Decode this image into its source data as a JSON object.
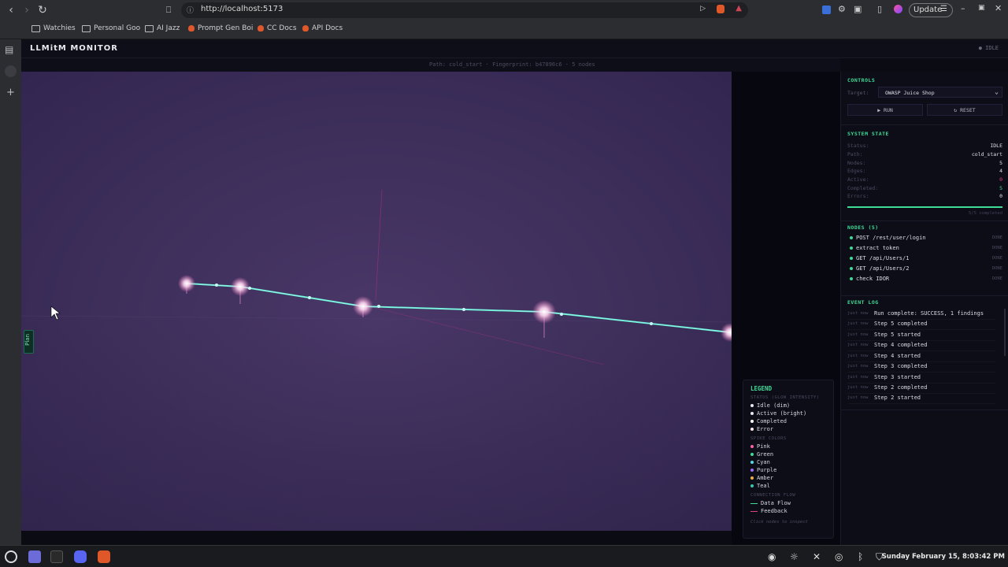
{
  "browser": {
    "url": "http://localhost:5173",
    "update_label": "Update",
    "bookmarks": [
      {
        "label": "Watchies",
        "type": "folder"
      },
      {
        "label": "Personal Goo",
        "type": "folder"
      },
      {
        "label": "AI Jazz",
        "type": "folder"
      },
      {
        "label": "Prompt Gen Boi",
        "type": "link"
      },
      {
        "label": "CC Docs",
        "type": "link"
      },
      {
        "label": "API Docs",
        "type": "link"
      }
    ]
  },
  "app": {
    "title": "LLMitM MONITOR",
    "header_status": "IDLE",
    "path_line": "Path: cold_start · Fingerprint: b47896c6 · 5 nodes",
    "plan_tab": "Plan"
  },
  "controls": {
    "title": "CONTROLS",
    "target_label": "Target:",
    "target_value": "OWASP Juice Shop",
    "run_label": "▶ RUN",
    "reset_label": "↻ RESET"
  },
  "system_state": {
    "title": "SYSTEM STATE",
    "rows": [
      {
        "key": "Status:",
        "value": "IDLE"
      },
      {
        "key": "Path:",
        "value": "cold_start"
      },
      {
        "key": "Nodes:",
        "value": "5"
      },
      {
        "key": "Edges:",
        "value": "4"
      },
      {
        "key": "Active:",
        "value": "0"
      },
      {
        "key": "Completed:",
        "value": "5"
      },
      {
        "key": "Errors:",
        "value": "0"
      }
    ],
    "progress": 1.0,
    "progress_text": "5/5 completed",
    "colors": {
      "active": "#e0437a",
      "completed": "#3ddc97"
    }
  },
  "nodes": {
    "title": "NODES (5)",
    "items": [
      {
        "label": "POST /rest/user/login",
        "status": "DONE"
      },
      {
        "label": "extract token",
        "status": "DONE"
      },
      {
        "label": "GET /api/Users/1",
        "status": "DONE"
      },
      {
        "label": "GET /api/Users/2",
        "status": "DONE"
      },
      {
        "label": "check IDOR",
        "status": "DONE"
      }
    ]
  },
  "event_log": {
    "title": "EVENT LOG",
    "items": [
      {
        "time": "just now",
        "message": "Run complete: SUCCESS, 1 findings"
      },
      {
        "time": "just now",
        "message": "Step 5 completed"
      },
      {
        "time": "just now",
        "message": "Step 5 started"
      },
      {
        "time": "just now",
        "message": "Step 4 completed"
      },
      {
        "time": "just now",
        "message": "Step 4 started"
      },
      {
        "time": "just now",
        "message": "Step 3 completed"
      },
      {
        "time": "just now",
        "message": "Step 3 started"
      },
      {
        "time": "just now",
        "message": "Step 2 completed"
      },
      {
        "time": "just now",
        "message": "Step 2 started"
      }
    ]
  },
  "legend": {
    "title": "LEGEND",
    "status_title": "STATUS (GLOW INTENSITY)",
    "status_items": [
      "Idle (dim)",
      "Active (bright)",
      "Completed",
      "Error"
    ],
    "spike_title": "SPIKE COLORS",
    "spike_items": [
      {
        "label": "Pink",
        "color": "#ff5fa8"
      },
      {
        "label": "Green",
        "color": "#3ddc97"
      },
      {
        "label": "Cyan",
        "color": "#4fd8e8"
      },
      {
        "label": "Purple",
        "color": "#a66bff"
      },
      {
        "label": "Amber",
        "color": "#f0b040"
      },
      {
        "label": "Teal",
        "color": "#38c8b0"
      }
    ],
    "flow_title": "CONNECTION FLOW",
    "flow_items": [
      {
        "label": "Data Flow",
        "color": "#3ddc97"
      },
      {
        "label": "Feedback",
        "color": "#e0437a"
      }
    ],
    "footer": "Click nodes to inspect"
  },
  "taskbar": {
    "clock": "Sunday February 15, 8:03:42 PM"
  }
}
